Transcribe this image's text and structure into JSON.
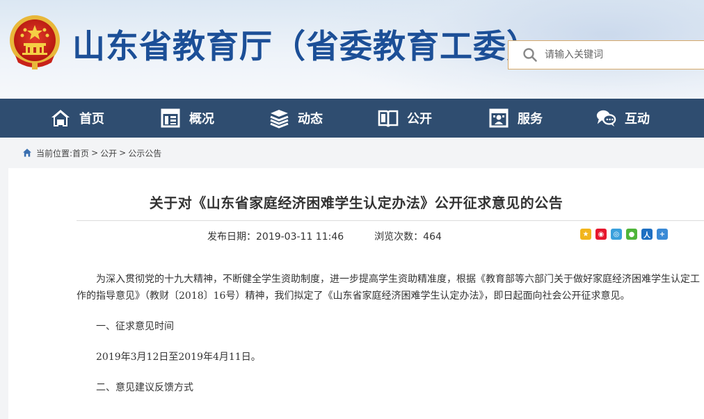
{
  "header": {
    "site_title": "山东省教育厅（省委教育工委）",
    "search_placeholder": "请输入关键词"
  },
  "nav": {
    "items": [
      {
        "label": "首页",
        "icon": "home-icon"
      },
      {
        "label": "概况",
        "icon": "building-icon"
      },
      {
        "label": "动态",
        "icon": "news-stack-icon"
      },
      {
        "label": "公开",
        "icon": "open-book-icon"
      },
      {
        "label": "服务",
        "icon": "service-icon"
      },
      {
        "label": "互动",
        "icon": "chat-bubble-icon"
      }
    ]
  },
  "breadcrumb": {
    "prefix": "当前位置:",
    "items": [
      "首页",
      "公开",
      "公示公告"
    ],
    "separator": ">"
  },
  "article": {
    "title": "关于对《山东省家庭经济困难学生认定办法》公开征求意见的公告",
    "publish_date": "发布日期：2019-03-11 11:46",
    "views": "浏览次数：464",
    "share_icons": [
      "qzone-icon",
      "weibo-icon",
      "tqq-icon",
      "wechat-icon",
      "renren-icon",
      "more-share-icon"
    ],
    "paragraphs": [
      "为深入贯彻党的十九大精神，不断健全学生资助制度，进一步提高学生资助精准度，根据《教育部等六部门关于做好家庭经济困难学生认定工作的指导意见》（教财〔2018〕16号）精神，我们拟定了《山东省家庭经济困难学生认定办法》，即日起面向社会公开征求意见。",
      "一、征求意见时间",
      "2019年3月12日至2019年4月11日。",
      "二、意见建议反馈方式"
    ]
  },
  "colors": {
    "title_blue": "#1c4f97",
    "nav_bg": "#2f4d70",
    "search_border": "#d7a96a"
  }
}
